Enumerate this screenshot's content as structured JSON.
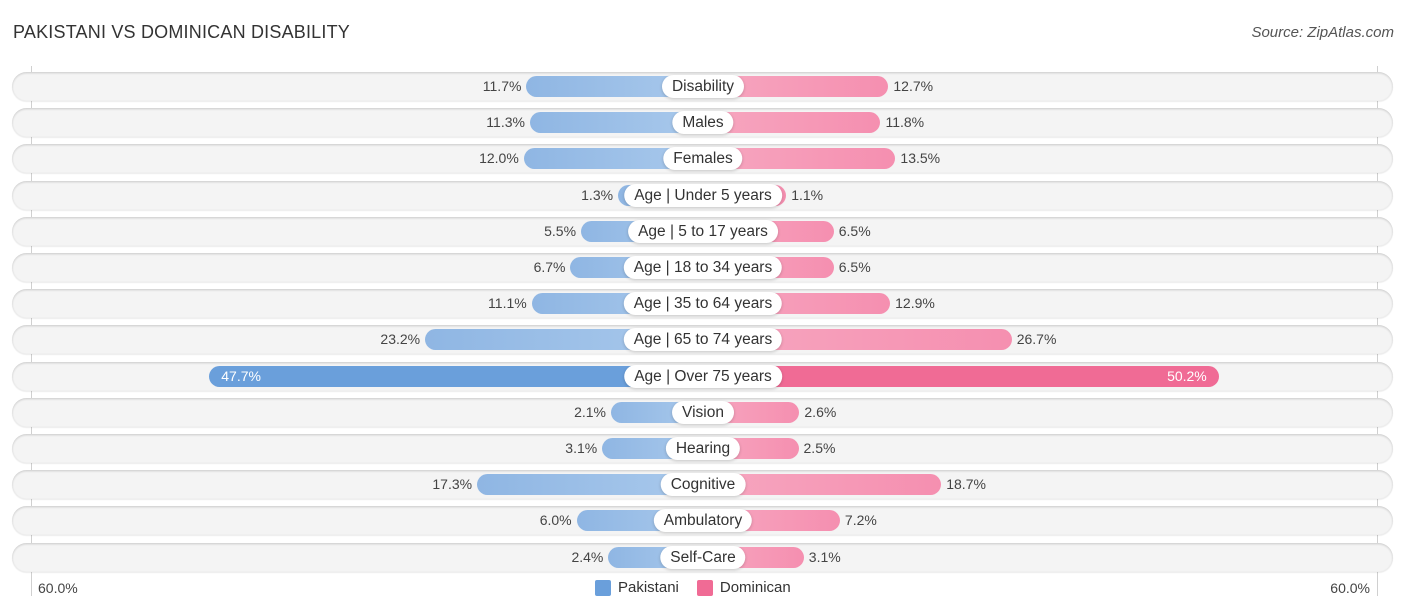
{
  "title": "PAKISTANI VS DOMINICAN DISABILITY",
  "source": "Source: ZipAtlas.com",
  "colors": {
    "pakistani": "#6a9fdb",
    "dominican": "#f06b95"
  },
  "chart_data": {
    "type": "bar",
    "orientation": "horizontal-diverging",
    "title": "PAKISTANI VS DOMINICAN DISABILITY",
    "categories": [
      "Disability",
      "Males",
      "Females",
      "Age | Under 5 years",
      "Age | 5 to 17 years",
      "Age | 18 to 34 years",
      "Age | 35 to 64 years",
      "Age | 65 to 74 years",
      "Age | Over 75 years",
      "Vision",
      "Hearing",
      "Cognitive",
      "Ambulatory",
      "Self-Care"
    ],
    "series": [
      {
        "name": "Pakistani",
        "side": "left",
        "values": [
          11.7,
          11.3,
          12.0,
          1.3,
          5.5,
          6.7,
          11.1,
          23.2,
          47.7,
          2.1,
          3.1,
          17.3,
          6.0,
          2.4
        ],
        "labels": [
          "11.7%",
          "11.3%",
          "12.0%",
          "1.3%",
          "5.5%",
          "6.7%",
          "11.1%",
          "23.2%",
          "47.7%",
          "2.1%",
          "3.1%",
          "17.3%",
          "6.0%",
          "2.4%"
        ]
      },
      {
        "name": "Dominican",
        "side": "right",
        "values": [
          12.7,
          11.8,
          13.5,
          1.1,
          6.5,
          6.5,
          12.9,
          26.7,
          50.2,
          2.6,
          2.5,
          18.7,
          7.2,
          3.1
        ],
        "labels": [
          "12.7%",
          "11.8%",
          "13.5%",
          "1.1%",
          "6.5%",
          "6.5%",
          "12.9%",
          "26.7%",
          "50.2%",
          "2.6%",
          "2.5%",
          "18.7%",
          "7.2%",
          "3.1%"
        ]
      }
    ],
    "axis": {
      "left_label": "60.0%",
      "right_label": "60.0%",
      "max": 60.0
    },
    "legend": {
      "position": "bottom-center",
      "items": [
        "Pakistani",
        "Dominican"
      ]
    }
  }
}
